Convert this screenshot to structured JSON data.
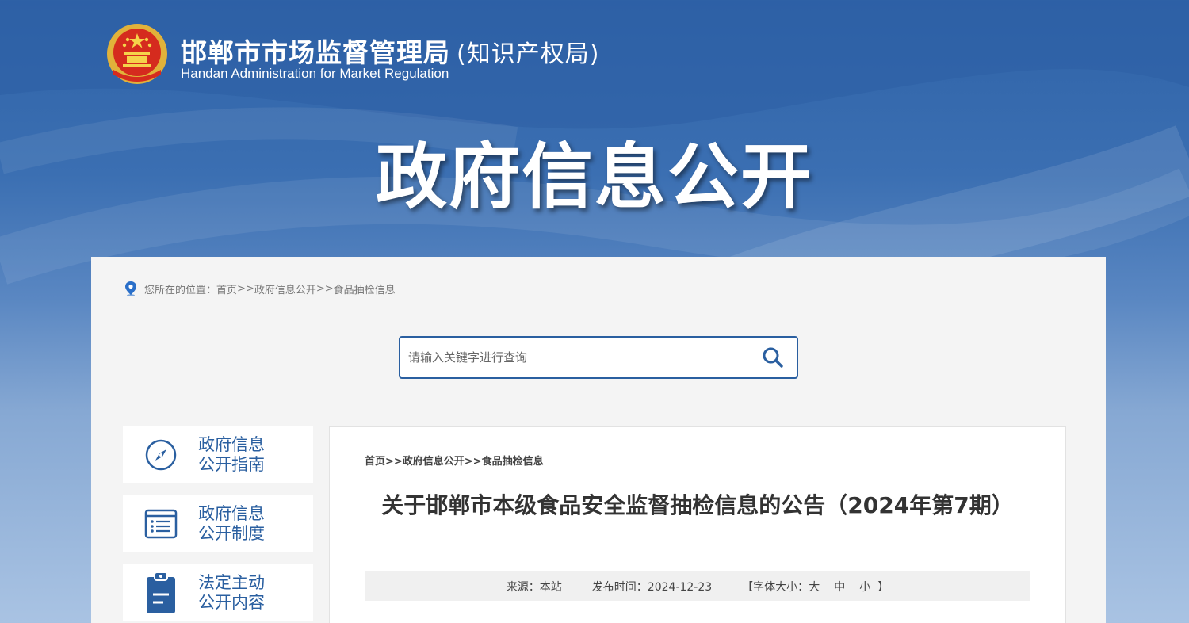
{
  "header": {
    "title": "邯郸市市场监督管理局",
    "title_sub": "(知识产权局)",
    "title_en": "Handan Administration for Market Regulation"
  },
  "banner": {
    "title": "政府信息公开"
  },
  "breadcrumb_top": {
    "prefix": "您所在的位置：",
    "home": "首页",
    "sep1": ">>",
    "level1": "政府信息公开",
    "sep2": ">>",
    "level2": "食品抽检信息"
  },
  "search": {
    "placeholder": "请输入关键字进行查询",
    "icon": "search-icon"
  },
  "side_nav": {
    "items": [
      {
        "line1": "政府信息",
        "line2": "公开指南",
        "icon": "compass-icon"
      },
      {
        "line1": "政府信息",
        "line2": "公开制度",
        "icon": "document-list-icon"
      },
      {
        "line1": "法定主动",
        "line2": "公开内容",
        "icon": "clipboard-icon"
      }
    ]
  },
  "article": {
    "breadcrumb": "首页>>政府信息公开>>食品抽检信息",
    "title": "关于邯郸市本级食品安全监督抽检信息的公告（2024年第7期）",
    "source": "来源：本站",
    "publish_time": "发布时间：2024-12-23",
    "font_size_prefix": "【字体大小：",
    "size_large": "大",
    "size_medium": "中",
    "size_small": "小",
    "font_size_suffix": "】"
  },
  "colors": {
    "primary": "#2a5fa0",
    "banner_top": "#2f63a8",
    "panel_bg": "#f4f4f4"
  }
}
